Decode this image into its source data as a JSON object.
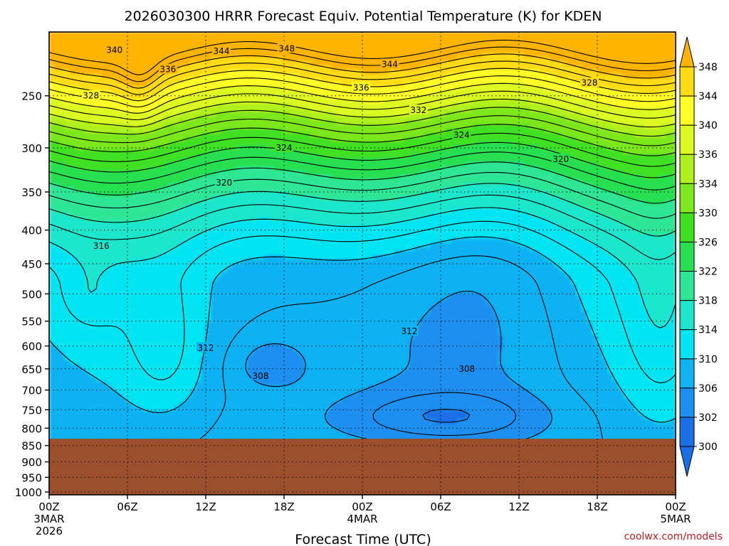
{
  "chart_data": {
    "type": "contour",
    "title": "2026030300 HRRR Forecast Equiv. Potential Temperature (K) for KDEN",
    "xlabel": "Forecast Time (UTC)",
    "ylabel": "",
    "x_ticks": [
      {
        "hour": 0,
        "lines": [
          "00Z",
          "3MAR",
          "2026"
        ]
      },
      {
        "hour": 6,
        "lines": [
          "06Z"
        ]
      },
      {
        "hour": 12,
        "lines": [
          "12Z"
        ]
      },
      {
        "hour": 18,
        "lines": [
          "18Z"
        ]
      },
      {
        "hour": 24,
        "lines": [
          "00Z",
          "4MAR"
        ]
      },
      {
        "hour": 30,
        "lines": [
          "06Z"
        ]
      },
      {
        "hour": 36,
        "lines": [
          "12Z"
        ]
      },
      {
        "hour": 42,
        "lines": [
          "18Z"
        ]
      },
      {
        "hour": 48,
        "lines": [
          "00Z",
          "5MAR"
        ]
      }
    ],
    "xlim": [
      0,
      48
    ],
    "y_ticks": [
      250,
      300,
      350,
      400,
      450,
      500,
      550,
      600,
      650,
      700,
      750,
      800,
      850,
      900,
      950,
      1000
    ],
    "y_axis": "pressure (log scale, inverted)",
    "ylim_top": 200,
    "ylim_bottom": 1010,
    "surface_pressure": 830,
    "grid": true,
    "colorbar": {
      "levels": [
        300,
        302,
        306,
        310,
        314,
        318,
        322,
        326,
        330,
        334,
        336,
        340,
        344,
        348
      ],
      "colors": [
        "#1a6ee6",
        "#1e8ff0",
        "#0fb2f2",
        "#00e5f2",
        "#1ee6cc",
        "#2ee696",
        "#26e050",
        "#40e020",
        "#7ce81e",
        "#b0f01e",
        "#dcfa22",
        "#ffff26",
        "#ffdc14",
        "#ffb400"
      ],
      "placement": "right"
    },
    "contour_labels": [
      {
        "value": "340",
        "hour": 5,
        "p": 213
      },
      {
        "value": "344",
        "hour": 13.2,
        "p": 214
      },
      {
        "value": "348",
        "hour": 18.2,
        "p": 212
      },
      {
        "value": "336",
        "hour": 9.1,
        "p": 228
      },
      {
        "value": "344",
        "hour": 26.1,
        "p": 224
      },
      {
        "value": "328",
        "hour": 3.2,
        "p": 250
      },
      {
        "value": "336",
        "hour": 23.9,
        "p": 243
      },
      {
        "value": "328",
        "hour": 41.4,
        "p": 239
      },
      {
        "value": "332",
        "hour": 28.3,
        "p": 263
      },
      {
        "value": "324",
        "hour": 18,
        "p": 300
      },
      {
        "value": "324",
        "hour": 31.6,
        "p": 287
      },
      {
        "value": "320",
        "hour": 39.2,
        "p": 312
      },
      {
        "value": "320",
        "hour": 13.4,
        "p": 339
      },
      {
        "value": "316",
        "hour": 4,
        "p": 423
      },
      {
        "value": "312",
        "hour": 27.6,
        "p": 570
      },
      {
        "value": "312",
        "hour": 12,
        "p": 604
      },
      {
        "value": "308",
        "hour": 32,
        "p": 650
      },
      {
        "value": "308",
        "hour": 16.2,
        "p": 667
      }
    ],
    "credit": "coolwx.com/models"
  }
}
